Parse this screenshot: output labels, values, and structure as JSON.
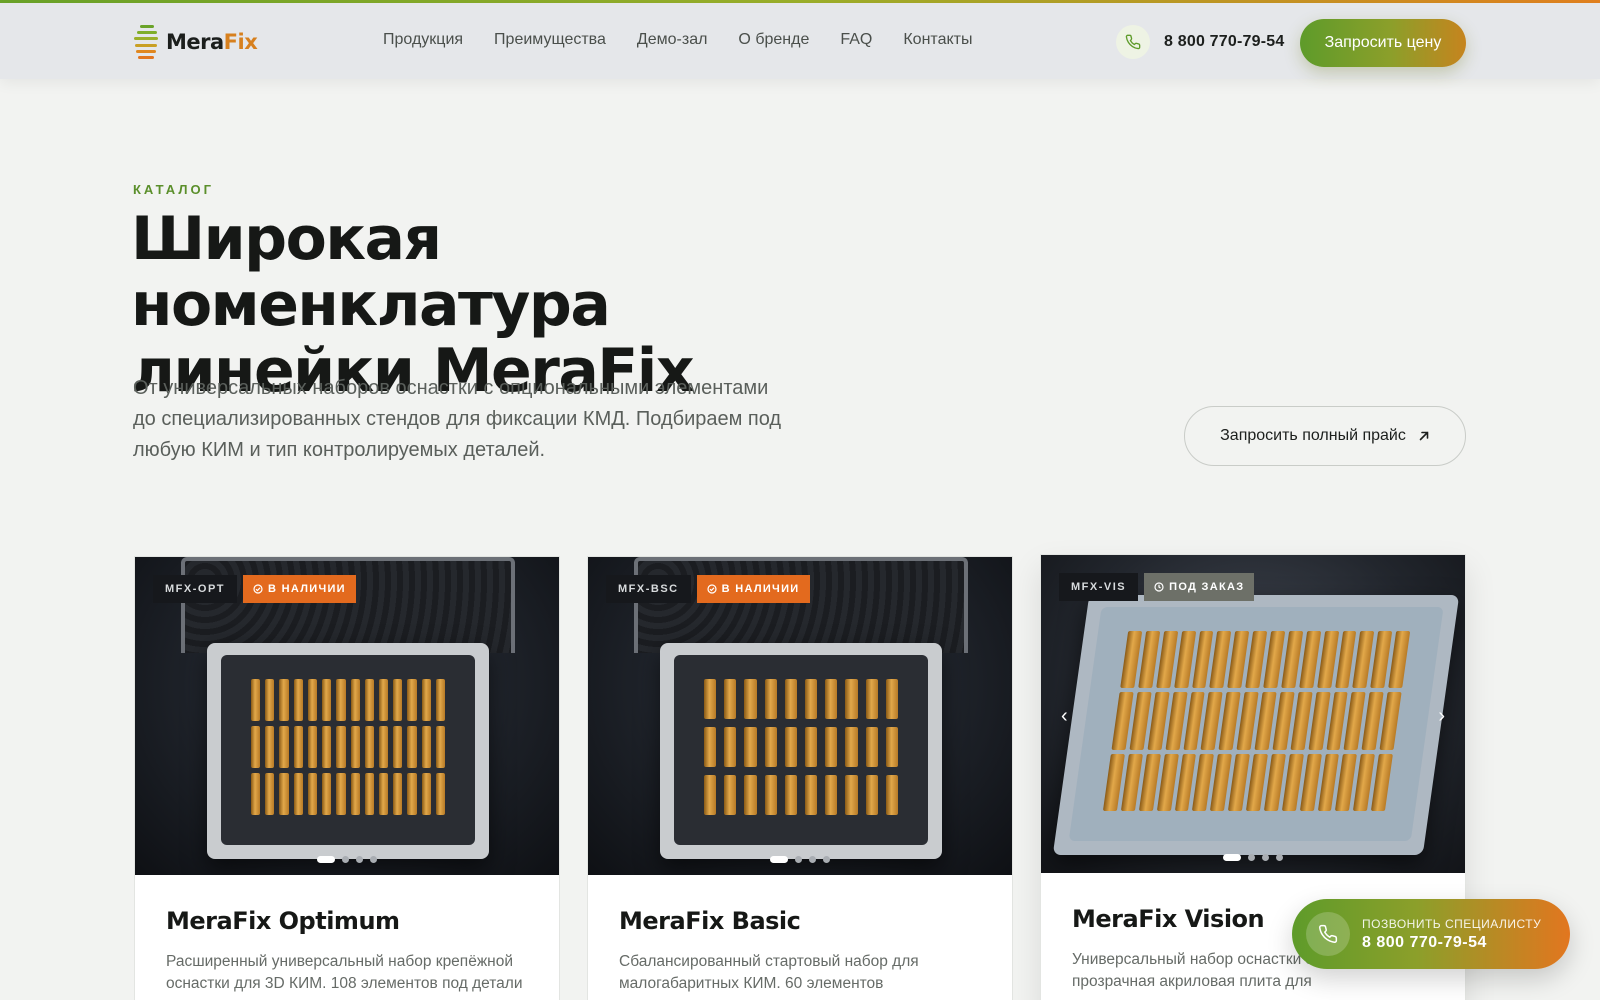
{
  "brand": {
    "name_main": "Mera",
    "name_accent": "Fix",
    "accent_color": "#d7801e",
    "primary_color": "#5e9b2a"
  },
  "nav": {
    "items": [
      {
        "label": "Продукция"
      },
      {
        "label": "Преимущества"
      },
      {
        "label": "Демо-зал"
      },
      {
        "label": "О бренде"
      },
      {
        "label": "FAQ"
      },
      {
        "label": "Контакты"
      }
    ]
  },
  "header": {
    "phone": "8 800 770-79-54",
    "cta_label": "Запросить цену"
  },
  "hero": {
    "eyebrow": "КАТАЛОГ",
    "title_line1": "Широкая номенклатура",
    "title_line2": "линейки MeraFix",
    "lead": "От универсальных наборов оснастки с опциональными элементами до специализированных стендов для фиксации КМД. Подбираем под любую КИМ и тип контролируемых деталей.",
    "price_button": "Запросить полный прайс",
    "price_icon": "arrow-up-right-icon"
  },
  "cards": [
    {
      "code": "MFX-OPT",
      "status": "В НАЛИЧИИ",
      "status_icon": "check-circle-icon",
      "title": "MeraFix Optimum",
      "description": "Расширенный универсальный набор крепёжной оснастки для 3D КИМ. 108 элементов под детали"
    },
    {
      "code": "MFX-BSC",
      "status": "В НАЛИЧИИ",
      "status_icon": "check-circle-icon",
      "title": "MeraFix Basic",
      "description": "Сбалансированный стартовый набор для малогабаритных КИМ. 60 элементов"
    },
    {
      "code": "MFX-VIS",
      "status": "ПОД ЗАКАЗ",
      "status_icon": "clock-icon",
      "title": "MeraFix Vision",
      "description": "Универсальный набор оснастки элементов и прозрачная акриловая плита для"
    }
  ],
  "float_call": {
    "label": "ПОЗВОНИТЬ СПЕЦИАЛИСТУ",
    "phone": "8 800 770-79-54",
    "icon": "phone-icon"
  }
}
